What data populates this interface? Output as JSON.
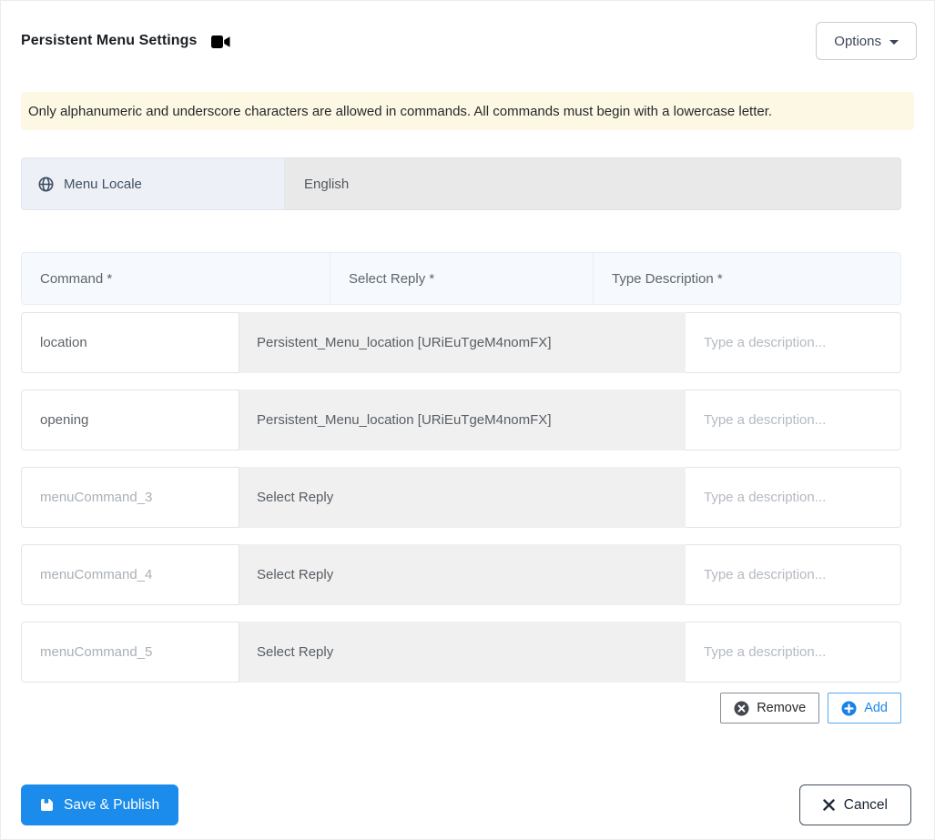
{
  "header": {
    "title": "Persistent Menu Settings",
    "options_label": "Options"
  },
  "alert": {
    "text": "Only alphanumeric and underscore characters are allowed in commands. All commands must begin with a lowercase letter."
  },
  "locale": {
    "label": "Menu Locale",
    "value": "English"
  },
  "table": {
    "headers": [
      "Command *",
      "Select Reply *",
      "Type Description *"
    ],
    "description_placeholder": "Type a description...",
    "rows": [
      {
        "command": "location",
        "command_is_placeholder": false,
        "reply": "Persistent_Menu_location [URiEuTgeM4nomFX]"
      },
      {
        "command": "opening",
        "command_is_placeholder": false,
        "reply": "Persistent_Menu_location [URiEuTgeM4nomFX]"
      },
      {
        "command": "menuCommand_3",
        "command_is_placeholder": true,
        "reply": "Select Reply"
      },
      {
        "command": "menuCommand_4",
        "command_is_placeholder": true,
        "reply": "Select Reply"
      },
      {
        "command": "menuCommand_5",
        "command_is_placeholder": true,
        "reply": "Select Reply"
      }
    ],
    "remove_label": "Remove",
    "add_label": "Add"
  },
  "footer": {
    "save_label": "Save & Publish",
    "cancel_label": "Cancel"
  },
  "icons": {
    "title": "video-camera",
    "locale": "globe",
    "options": "caret-down",
    "remove": "circle-x",
    "add": "circle-plus",
    "save": "floppy-disk",
    "cancel": "x"
  },
  "colors": {
    "accent_blue": "#1b8ceb",
    "alert_bg": "#fdf8e3",
    "locale_label_bg": "#edf1f7",
    "disabled_input_bg": "#e9e9e9",
    "table_header_bg": "#f6f9fd",
    "reply_box_bg": "#f0f0f0",
    "remove_border": "#868d93",
    "add_border": "#56a9ec"
  }
}
